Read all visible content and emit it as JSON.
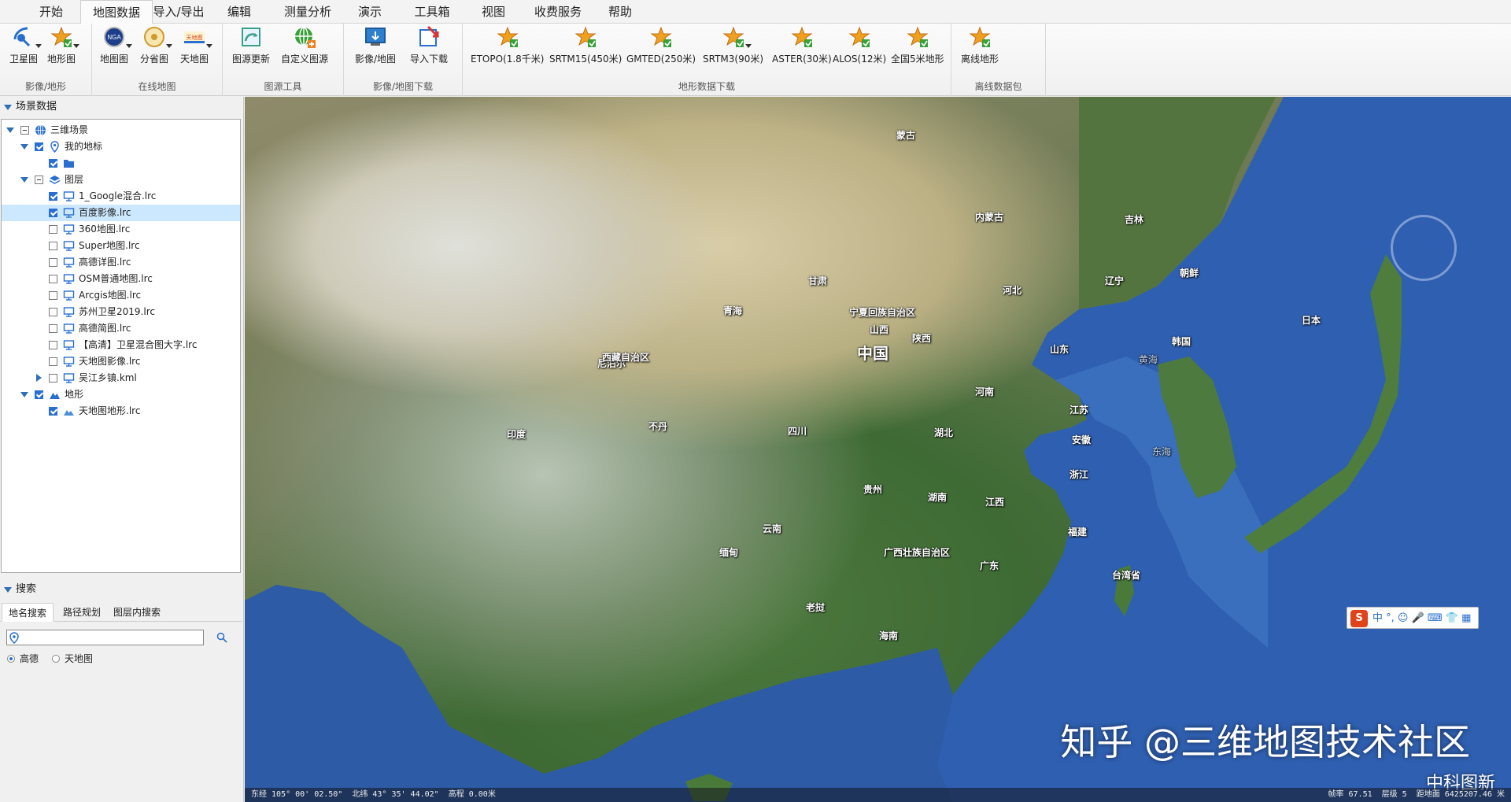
{
  "menu": [
    "开始",
    "地图数据",
    "导入/导出",
    "编辑",
    "测量分析",
    "演示",
    "工具箱",
    "视图",
    "收费服务",
    "帮助"
  ],
  "menu_active": "地图数据",
  "ribbon": {
    "groups": [
      {
        "label": "影像/地形",
        "buttons": [
          "卫星图",
          "地形图"
        ]
      },
      {
        "label": "在线地图",
        "buttons": [
          "地图图",
          "分省图",
          "天地图"
        ]
      },
      {
        "label": "图源工具",
        "buttons": [
          "图源更新",
          "自定义图源"
        ]
      },
      {
        "label": "影像/地图下载",
        "buttons": [
          "影像/地图",
          "导入下载"
        ]
      },
      {
        "label": "地形数据下载",
        "buttons": [
          "ETOPO(1.8千米)",
          "SRTM15(450米)",
          "GMTED(250米)",
          "SRTM3(90米)",
          "ASTER(30米)",
          "ALOS(12米)",
          "全国5米地形"
        ]
      },
      {
        "label": "离线数据包",
        "buttons": [
          "离线地形"
        ]
      }
    ]
  },
  "scene": {
    "title": "场景数据",
    "tree": [
      {
        "label": "三维场景",
        "level": 0,
        "expanded": true,
        "check": "part",
        "icon": "globe-icon"
      },
      {
        "label": "我的地标",
        "level": 1,
        "expanded": true,
        "check": "on",
        "icon": "pin-icon"
      },
      {
        "label": "",
        "level": 2,
        "check": "on",
        "icon": "folder-icon"
      },
      {
        "label": "图层",
        "level": 1,
        "expanded": true,
        "check": "part",
        "icon": "layers-icon"
      },
      {
        "label": "1_Google混合.lrc",
        "level": 2,
        "check": "on",
        "icon": "monitor-icon"
      },
      {
        "label": "百度影像.lrc",
        "level": 2,
        "check": "on",
        "icon": "monitor-icon",
        "selected": true
      },
      {
        "label": "360地图.lrc",
        "level": 2,
        "check": "off",
        "icon": "monitor-icon"
      },
      {
        "label": "Super地图.lrc",
        "level": 2,
        "check": "off",
        "icon": "monitor-icon"
      },
      {
        "label": "高德详图.lrc",
        "level": 2,
        "check": "off",
        "icon": "monitor-icon"
      },
      {
        "label": "OSM普通地图.lrc",
        "level": 2,
        "check": "off",
        "icon": "monitor-icon"
      },
      {
        "label": "Arcgis地图.lrc",
        "level": 2,
        "check": "off",
        "icon": "monitor-icon"
      },
      {
        "label": "苏州卫星2019.lrc",
        "level": 2,
        "check": "off",
        "icon": "monitor-icon"
      },
      {
        "label": "高德简图.lrc",
        "level": 2,
        "check": "off",
        "icon": "monitor-icon"
      },
      {
        "label": "【高清】卫星混合图大字.lrc",
        "level": 2,
        "check": "off",
        "icon": "monitor-icon"
      },
      {
        "label": "天地图影像.lrc",
        "level": 2,
        "check": "off",
        "icon": "monitor-icon"
      },
      {
        "label": "吴江乡镇.kml",
        "level": 2,
        "expanded": false,
        "check": "off",
        "icon": "monitor-icon"
      },
      {
        "label": "地形",
        "level": 1,
        "expanded": true,
        "check": "on",
        "icon": "mountain-icon"
      },
      {
        "label": "天地图地形.lrc",
        "level": 2,
        "check": "on",
        "icon": "terrain-icon"
      }
    ]
  },
  "search": {
    "title": "搜索",
    "tabs": [
      "地名搜索",
      "路径规划",
      "图层内搜索"
    ],
    "active_tab": "地名搜索",
    "input_value": "",
    "sources": [
      "高德",
      "天地图"
    ],
    "selected_source": "高德"
  },
  "map": {
    "labels": [
      "蒙古",
      "中国",
      "印度",
      "不丹",
      "尼泊尔",
      "缅甸",
      "老挝",
      "海南",
      "台湾省",
      "韩国",
      "朝鲜",
      "日本",
      "黄海",
      "东海",
      "山东",
      "河南",
      "陕西",
      "山西",
      "四川",
      "贵州",
      "湖南",
      "湖北",
      "江西",
      "浙江",
      "江苏",
      "安徽",
      "福建",
      "广东",
      "云南",
      "河北",
      "内蒙古",
      "广西壮族自治区",
      "宁夏回族自治区",
      "西藏自治区",
      "青海",
      "甘肃",
      "吉林",
      "辽宁"
    ],
    "watermark": "知乎 @三维地图技术社区",
    "watermark2": "中科图新",
    "status_left": "东经 105° 00' 02.50\"  北纬 43° 35' 44.02\"  高程 0.00米",
    "status_right": "帧率 67.51  层级 5  距地面 6425207.46 米",
    "ime": "中 °, ☺ 🎤 ⌨ 👕 ▦"
  }
}
